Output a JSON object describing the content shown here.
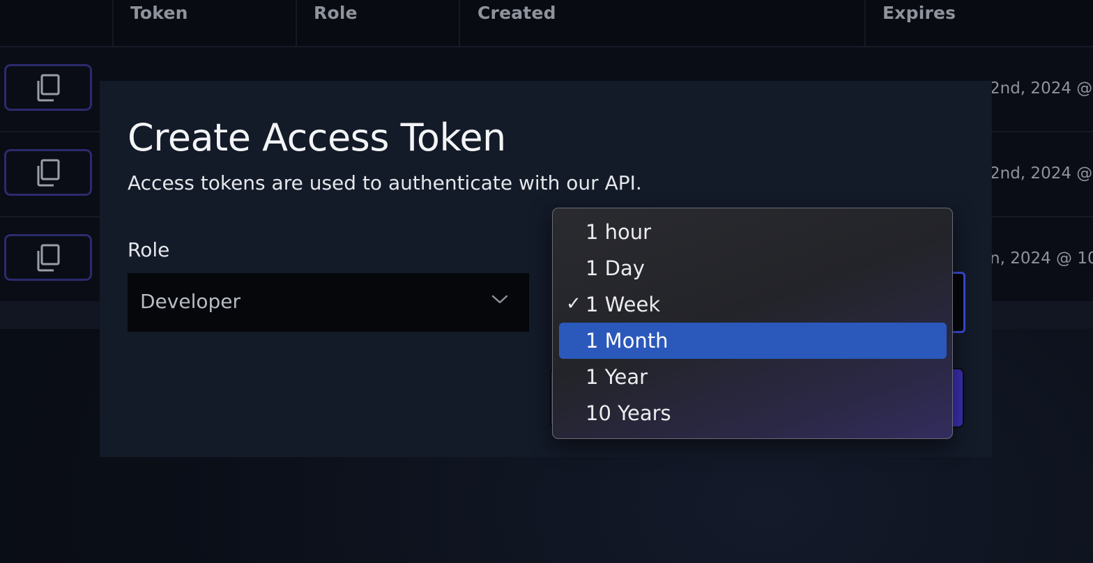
{
  "table": {
    "columns": [
      "Token",
      "Role",
      "Created",
      "Expires"
    ],
    "rows": [
      {
        "expires_partial": "2nd, 2024 @"
      },
      {
        "expires_partial": "2nd, 2024 @"
      },
      {
        "expires_partial": "n, 2024 @ 10"
      }
    ],
    "copy_icon": "copy-icon"
  },
  "modal": {
    "title": "Create Access Token",
    "description": "Access tokens are used to authenticate with our API.",
    "role": {
      "label": "Role",
      "value": "Developer",
      "icon": "chevron-down-icon"
    }
  },
  "expires_menu": {
    "options": [
      {
        "label": "1 hour",
        "checked": false,
        "highlighted": false
      },
      {
        "label": "1 Day",
        "checked": false,
        "highlighted": false
      },
      {
        "label": "1 Week",
        "checked": true,
        "highlighted": false
      },
      {
        "label": "1 Month",
        "checked": false,
        "highlighted": true
      },
      {
        "label": "1 Year",
        "checked": false,
        "highlighted": false
      },
      {
        "label": "10 Years",
        "checked": false,
        "highlighted": false
      }
    ],
    "check_glyph": "✓",
    "highlight_color": "#2b58bb"
  },
  "colors": {
    "modal_bg": "#131a28",
    "accent": "#3a2fb0",
    "focus_border": "#3b4bd8"
  }
}
